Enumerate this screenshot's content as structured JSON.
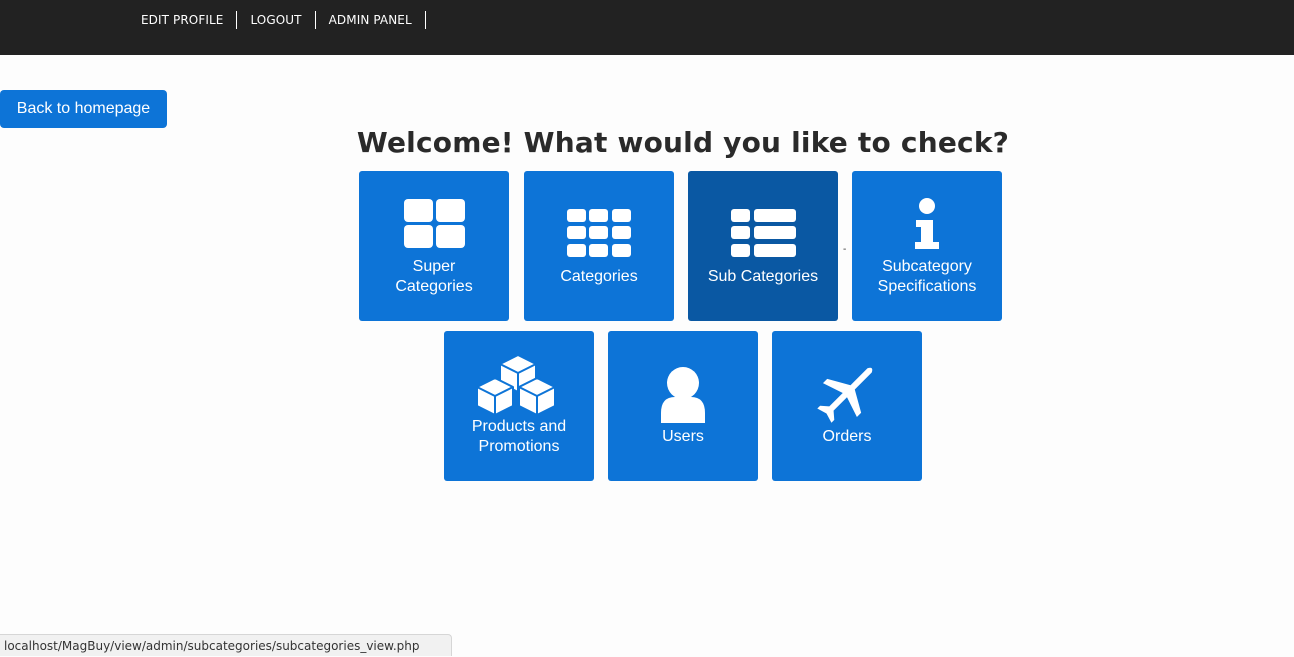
{
  "nav": {
    "items": [
      "EDIT PROFILE",
      "LOGOUT",
      "ADMIN PANEL"
    ]
  },
  "back_button": "Back to homepage",
  "heading": "Welcome! What would you like to check?",
  "tiles": [
    {
      "label_lines": [
        "Super",
        "Categories"
      ],
      "icon": "grid-large-icon"
    },
    {
      "label_lines": [
        "Categories"
      ],
      "icon": "grid-small-icon"
    },
    {
      "label_lines": [
        "Sub Categories"
      ],
      "icon": "list-icon",
      "active": true
    },
    {
      "label_lines": [
        "Subcategory",
        "Specifications"
      ],
      "icon": "info-icon"
    },
    {
      "label_lines": [
        "Products and",
        "Promotions"
      ],
      "icon": "cubes-icon"
    },
    {
      "label_lines": [
        "Users"
      ],
      "icon": "user-icon"
    },
    {
      "label_lines": [
        "Orders"
      ],
      "icon": "plane-icon"
    }
  ],
  "status_url": "localhost/MagBuy/view/admin/subcategories/subcategories_view.php",
  "colors": {
    "topbar": "#222222",
    "tile": "#0d74d7",
    "tile_active": "#0a58a3"
  }
}
